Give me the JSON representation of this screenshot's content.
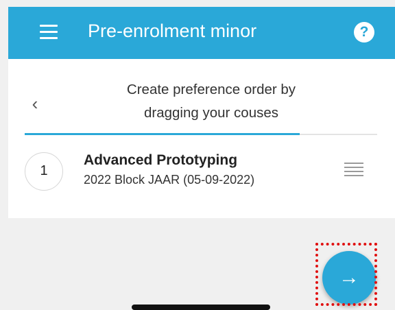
{
  "appbar": {
    "title": "Pre-enrolment minor",
    "menu_icon": "menu-icon",
    "help_glyph": "?"
  },
  "wizard": {
    "back_glyph": "‹",
    "instruction_line1": "Create preference order by",
    "instruction_line2": "dragging your couses",
    "progress": 0.78
  },
  "courses": [
    {
      "rank": "1",
      "title": "Advanced Prototyping",
      "subtitle": "2022 Block JAAR (05-09-2022)"
    }
  ],
  "fab": {
    "glyph": "→"
  },
  "colors": {
    "accent": "#2aa8d8",
    "background": "#f0f0f0",
    "highlight": "#e01010"
  }
}
